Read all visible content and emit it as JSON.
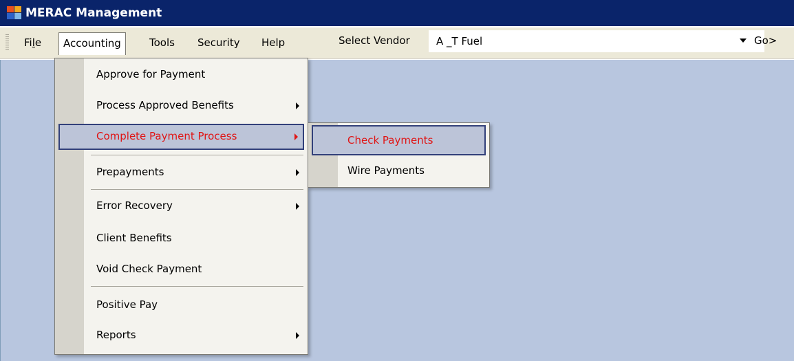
{
  "window": {
    "title": "MERAC Management",
    "icon": "app-window-icon"
  },
  "menubar": {
    "items": [
      {
        "pre": "Fi",
        "mn": "l",
        "post": "e"
      },
      {
        "pre": "",
        "mn": "",
        "post": "Accounting"
      },
      {
        "pre": "",
        "mn": "",
        "post": "Tools"
      },
      {
        "pre": "",
        "mn": "",
        "post": "Security"
      },
      {
        "pre": "",
        "mn": "",
        "post": "Help"
      }
    ],
    "vendor_label": "Select Vendor",
    "vendor_value": "A _T Fuel",
    "go_label": "Go>"
  },
  "accounting_menu": {
    "items": [
      {
        "label": "Approve for Payment"
      },
      {
        "label": "Process Approved Benefits",
        "has_submenu": true
      },
      {
        "label": "Complete Payment Process",
        "has_submenu": true,
        "highlighted": true
      },
      {
        "label": "Prepayments",
        "has_submenu": true
      },
      {
        "label": "Error Recovery",
        "has_submenu": true
      },
      {
        "label": "Client Benefits"
      },
      {
        "label": "Void Check Payment"
      },
      {
        "label": "Positive Pay"
      },
      {
        "label": "Reports",
        "has_submenu": true
      }
    ]
  },
  "payment_submenu": {
    "items": [
      {
        "label": "Check Payments",
        "highlighted": true
      },
      {
        "label": "Wire Payments"
      }
    ]
  },
  "colors": {
    "titlebar": "#0a246a",
    "workspace": "#b8c6df",
    "highlight_text": "#e01515",
    "highlight_border": "#32407a"
  }
}
